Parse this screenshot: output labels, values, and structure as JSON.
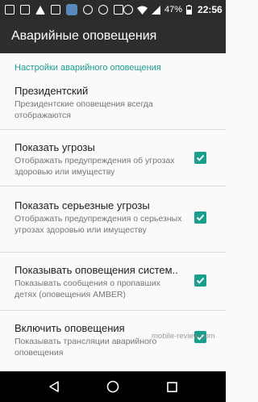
{
  "status_bar": {
    "time": "22:56",
    "battery": "47%",
    "icons": [
      "gallery-icon",
      "mail-icon",
      "warning-icon",
      "contacts-icon",
      "vk-icon",
      "sync-icon",
      "compass-icon",
      "download-icon",
      "alarm-icon",
      "wifi-icon",
      "signal-icon",
      "battery-icon"
    ]
  },
  "app_bar": {
    "title": "Аварийные оповещения"
  },
  "section": {
    "header": "Настройки аварийного оповещения"
  },
  "prefs": [
    {
      "title": "Президентский",
      "summary": "Президентские оповещения всегда отображаются",
      "checkbox": false
    },
    {
      "title": "Показать угрозы",
      "summary": "Отображать предупреждения об угрозах здоровью или имуществу",
      "checkbox": true
    },
    {
      "title": "Показать серьезные угрозы",
      "summary": "Отображать предупреждения о серьезных угрозах здоровью или имуществу",
      "checkbox": true
    },
    {
      "title": "Показывать оповещения систем..",
      "summary": "Показывать сообщения о пропавших детях (оповещения AMBER)",
      "checkbox": true
    },
    {
      "title": "Включить оповещения",
      "summary": "Показывать трансляции аварийного оповещения",
      "checkbox": true
    }
  ],
  "watermark": "mobile-review.com",
  "colors": {
    "accent": "#1a9e8d",
    "app_bar": "#2e2e2e",
    "status_bar": "#2b2b2b"
  }
}
